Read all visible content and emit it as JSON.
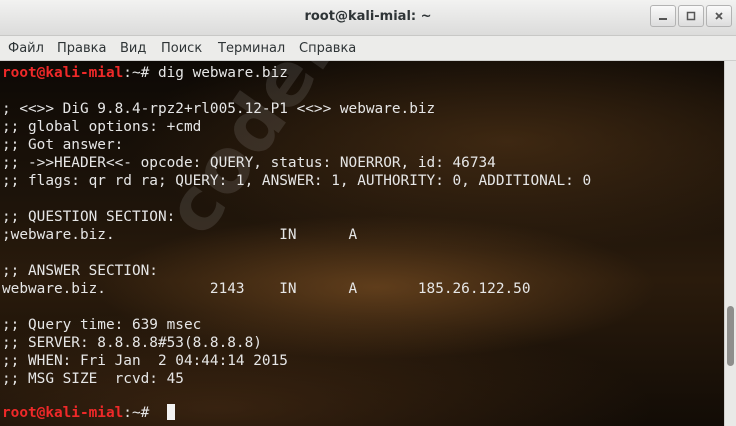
{
  "window": {
    "title": "root@kali-mial: ~"
  },
  "menu": {
    "items": [
      "Файл",
      "Правка",
      "Вид",
      "Поиск",
      "Терминал",
      "Справка"
    ]
  },
  "terminal": {
    "prompt_user": "root@kali-mial",
    "prompt_sep": ":~# ",
    "command": "dig webware.biz",
    "output": [
      "; <<>> DiG 9.8.4-rpz2+rl005.12-P1 <<>> webware.biz",
      ";; global options: +cmd",
      ";; Got answer:",
      ";; ->>HEADER<<- opcode: QUERY, status: NOERROR, id: 46734",
      ";; flags: qr rd ra; QUERY: 1, ANSWER: 1, AUTHORITY: 0, ADDITIONAL: 0",
      "",
      ";; QUESTION SECTION:",
      ";webware.biz.                   IN      A",
      "",
      ";; ANSWER SECTION:",
      "webware.biz.            2143    IN      A       185.26.122.50",
      "",
      ";; Query time: 639 msec",
      ";; SERVER: 8.8.8.8#53(8.8.8.8)",
      ";; WHEN: Fri Jan  2 04:44:14 2015",
      ";; MSG SIZE  rcvd: 45"
    ],
    "watermark": "codeby.net"
  },
  "colors": {
    "prompt_user": "#ef2929",
    "text": "#e6e6e6",
    "titlebar": "#e8e8e7"
  }
}
